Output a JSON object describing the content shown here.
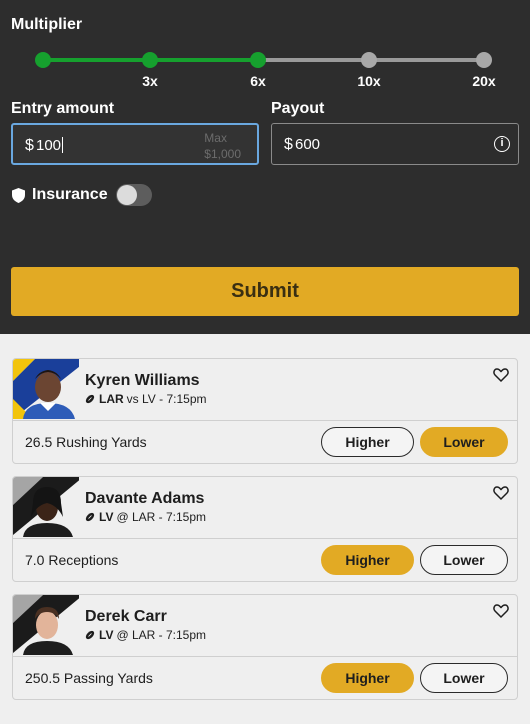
{
  "multiplier": {
    "title": "Multiplier",
    "ticks": [
      "3x",
      "6x",
      "10x",
      "20x"
    ],
    "selected_label": "6x"
  },
  "entry": {
    "label": "Entry amount",
    "currency": "$",
    "value": "100",
    "max_label": "Max",
    "max_value": "$1,000"
  },
  "payout": {
    "label": "Payout",
    "currency": "$",
    "value": "600"
  },
  "insurance": {
    "label": "Insurance",
    "enabled": false
  },
  "submit_label": "Submit",
  "colors": {
    "accent": "#e2aa24",
    "slider_active": "#16a02e",
    "dark_panel": "#2d2d2d",
    "focus_border": "#6aa8e0"
  },
  "picks": [
    {
      "name": "Kyren Williams",
      "team": "LAR",
      "matchup": "vs LV - 7:15pm",
      "stat": "26.5 Rushing Yards",
      "higher_label": "Higher",
      "lower_label": "Lower",
      "selected": "lower"
    },
    {
      "name": "Davante Adams",
      "team": "LV",
      "matchup": "@ LAR - 7:15pm",
      "stat": "7.0 Receptions",
      "higher_label": "Higher",
      "lower_label": "Lower",
      "selected": "higher"
    },
    {
      "name": "Derek Carr",
      "team": "LV",
      "matchup": "@ LAR - 7:15pm",
      "stat": "250.5 Passing Yards",
      "higher_label": "Higher",
      "lower_label": "Lower",
      "selected": "higher"
    }
  ]
}
